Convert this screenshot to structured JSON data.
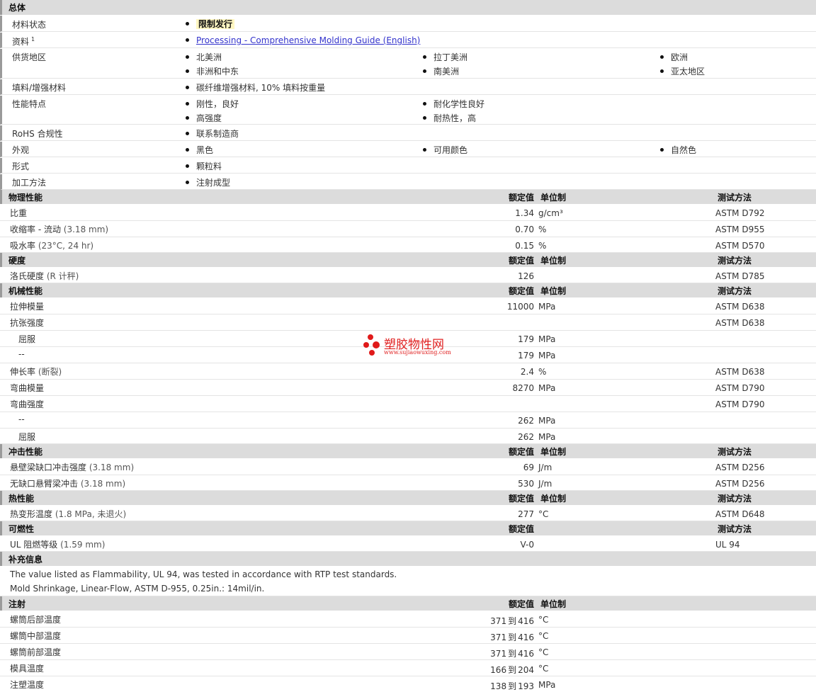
{
  "general": {
    "title": "总体",
    "material_status": {
      "label": "材料状态",
      "value": "限制发行"
    },
    "literature": {
      "label": "资料",
      "sup": "1",
      "link": "Processing - Comprehensive Molding Guide (English)"
    },
    "availability": {
      "label": "供货地区",
      "items": [
        "北美洲",
        "拉丁美洲",
        "欧洲",
        "非洲和中东",
        "南美洲",
        "亚太地区"
      ]
    },
    "filler": {
      "label": "填料/增强材料",
      "value": "碳纤维增强材料, 10% 填料按重量"
    },
    "features": {
      "label": "性能特点",
      "items": [
        "刚性，良好",
        "耐化学性良好",
        "高强度",
        "耐热性，高"
      ]
    },
    "rohs": {
      "label": "RoHS 合规性",
      "value": "联系制造商"
    },
    "appearance": {
      "label": "外观",
      "items": [
        "黑色",
        "可用颜色",
        "自然色"
      ]
    },
    "form": {
      "label": "形式",
      "value": "颗粒料"
    },
    "processing": {
      "label": "加工方法",
      "value": "注射成型"
    }
  },
  "headers": {
    "nominal": "额定值",
    "unit": "单位制",
    "test": "测试方法"
  },
  "physical": {
    "title": "物理性能",
    "rows": [
      {
        "label": "比重",
        "cond": "",
        "value": "1.34",
        "unit": "g/cm³",
        "test": "ASTM D792"
      },
      {
        "label": "收缩率  - 流动",
        "cond": "(3.18 mm)",
        "value": "0.70",
        "unit": "%",
        "test": "ASTM D955"
      },
      {
        "label": "吸水率",
        "cond": "(23°C, 24 hr)",
        "value": "0.15",
        "unit": "%",
        "test": "ASTM D570"
      }
    ]
  },
  "hardness": {
    "title": "硬度",
    "rows": [
      {
        "label": "洛氏硬度",
        "cond": "(R 计秤)",
        "value": "126",
        "unit": "",
        "test": "ASTM D785"
      }
    ]
  },
  "mechanical": {
    "title": "机械性能",
    "rows": [
      {
        "label": "拉伸模量",
        "value": "11000",
        "unit": "MPa",
        "test": "ASTM D638"
      },
      {
        "label": "抗张强度",
        "value": "",
        "unit": "",
        "test": "ASTM D638"
      },
      {
        "label": "屈服",
        "value": "179",
        "unit": "MPa",
        "test": ""
      },
      {
        "label": "--",
        "value": "179",
        "unit": "MPa",
        "test": ""
      },
      {
        "label": "伸长率",
        "cond": "(断裂)",
        "value": "2.4",
        "unit": "%",
        "test": "ASTM D638"
      },
      {
        "label": "弯曲模量",
        "value": "8270",
        "unit": "MPa",
        "test": "ASTM D790"
      },
      {
        "label": "弯曲强度",
        "value": "",
        "unit": "",
        "test": "ASTM D790"
      },
      {
        "label": "--",
        "value": "262",
        "unit": "MPa",
        "test": ""
      },
      {
        "label": "屈服",
        "value": "262",
        "unit": "MPa",
        "test": ""
      }
    ]
  },
  "impact": {
    "title": "冲击性能",
    "rows": [
      {
        "label": "悬壁梁缺口冲击强度",
        "cond": "(3.18 mm)",
        "value": "69",
        "unit": "J/m",
        "test": "ASTM D256"
      },
      {
        "label": "无缺口悬臂梁冲击",
        "cond": "(3.18 mm)",
        "value": "530",
        "unit": "J/m",
        "test": "ASTM D256"
      }
    ]
  },
  "thermal": {
    "title": "热性能",
    "rows": [
      {
        "label": "热变形温度",
        "cond": "(1.8 MPa, 未退火)",
        "value": "277",
        "unit": "°C",
        "test": "ASTM D648"
      }
    ]
  },
  "flammability": {
    "title": "可燃性",
    "rows": [
      {
        "label": "UL 阻燃等级",
        "cond": "(1.59 mm)",
        "value": "V-0",
        "unit": "",
        "test": "UL 94"
      }
    ]
  },
  "supplemental": {
    "title": "补充信息",
    "notes": [
      "The value listed as Flammability, UL 94, was tested in accordance with RTP test standards.",
      "Mold Shrinkage, Linear-Flow, ASTM D-955, 0.25in.: 14mil/in."
    ]
  },
  "injection": {
    "title": "注射",
    "to": "到",
    "rows": [
      {
        "label": "螺筒后部温度",
        "from": "371",
        "upto": "416",
        "unit": "°C"
      },
      {
        "label": "螺筒中部温度",
        "from": "371",
        "upto": "416",
        "unit": "°C"
      },
      {
        "label": "螺筒前部温度",
        "from": "371",
        "upto": "416",
        "unit": "°C"
      },
      {
        "label": "模具温度",
        "from": "166",
        "upto": "204",
        "unit": "°C"
      },
      {
        "label": "注塑温度",
        "from": "138",
        "upto": "193",
        "unit": "MPa"
      }
    ]
  },
  "watermark": {
    "title": "塑胶物性网",
    "url": "www.sujiaowuxing.com",
    "color": "#e02020"
  }
}
